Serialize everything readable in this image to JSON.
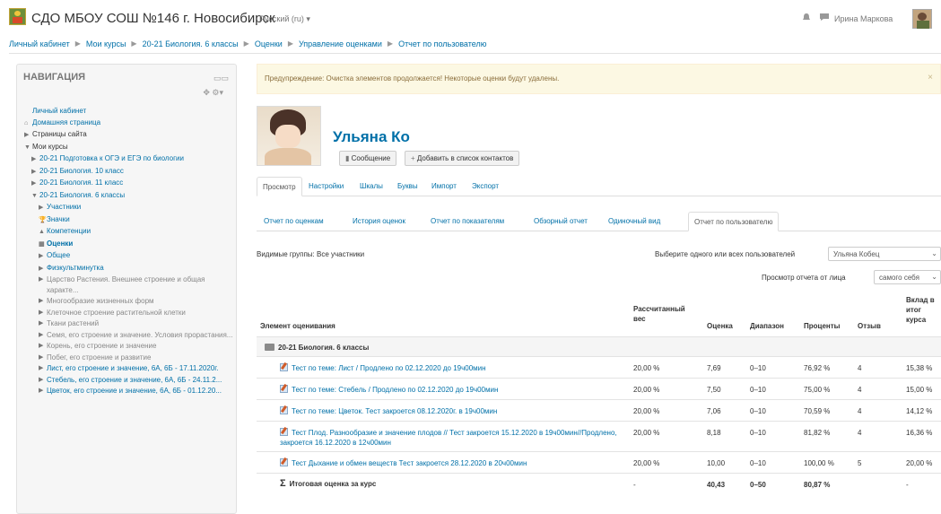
{
  "header": {
    "site_name": "СДО МБОУ СОШ №146 г. Новосибирск",
    "language": "Русский (ru) ▾",
    "user_name": "Ирина Маркова"
  },
  "breadcrumb": [
    "Личный кабинет",
    "Мои курсы",
    "20-21 Биология. 6 классы",
    "Оценки",
    "Управление оценками",
    "Отчет по пользователю"
  ],
  "navigation": {
    "title": "НАВИГАЦИЯ",
    "items": [
      {
        "label": "Личный кабинет",
        "arrow": "",
        "style": "link",
        "indent": 0
      },
      {
        "label": "Домашняя страница",
        "arrow": "⌂",
        "style": "link",
        "indent": 0
      },
      {
        "label": "Страницы сайта",
        "arrow": "▶",
        "style": "black",
        "indent": 0
      },
      {
        "label": "Мои курсы",
        "arrow": "▼",
        "style": "black",
        "indent": 0
      },
      {
        "label": "20-21 Подготовка к ОГЭ и ЕГЭ по биологии",
        "arrow": "▶",
        "style": "link",
        "indent": 1
      },
      {
        "label": "20-21 Биология. 10 класс",
        "arrow": "▶",
        "style": "link",
        "indent": 1
      },
      {
        "label": "20-21 Биология. 11 класс",
        "arrow": "▶",
        "style": "link",
        "indent": 1
      },
      {
        "label": "20-21 Биология. 6 классы",
        "arrow": "▼",
        "style": "link",
        "indent": 1
      },
      {
        "label": "Участники",
        "arrow": "▶",
        "style": "link",
        "indent": 2
      },
      {
        "label": "Значки",
        "arrow": "🏆",
        "style": "link",
        "indent": 2
      },
      {
        "label": "Компетенции",
        "arrow": "▲",
        "style": "link",
        "indent": 2
      },
      {
        "label": "Оценки",
        "arrow": "▦",
        "style": "bold",
        "indent": 2
      },
      {
        "label": "Общее",
        "arrow": "▶",
        "style": "link",
        "indent": 2
      },
      {
        "label": "Физкультминутка",
        "arrow": "▶",
        "style": "link",
        "indent": 2
      },
      {
        "label": "Царство Растения. Внешнее строение и общая характе...",
        "arrow": "▶",
        "style": "grey",
        "indent": 2
      },
      {
        "label": "Многообразие жизненных форм",
        "arrow": "▶",
        "style": "grey",
        "indent": 2
      },
      {
        "label": "Клеточное строение растительной клетки",
        "arrow": "▶",
        "style": "grey",
        "indent": 2
      },
      {
        "label": "Ткани растений",
        "arrow": "▶",
        "style": "grey",
        "indent": 2
      },
      {
        "label": "Семя, его строение и значение. Условия прорастания...",
        "arrow": "▶",
        "style": "grey",
        "indent": 2
      },
      {
        "label": "Корень, его строение и значение",
        "arrow": "▶",
        "style": "grey",
        "indent": 2
      },
      {
        "label": "Побег, его строение и развитие",
        "arrow": "▶",
        "style": "grey",
        "indent": 2
      },
      {
        "label": "Лист, его строение и значение, 6А, 6Б - 17.11.2020г.",
        "arrow": "▶",
        "style": "link",
        "indent": 2
      },
      {
        "label": "Стебель, его строение и значение, 6А, 6Б - 24.11.2...",
        "arrow": "▶",
        "style": "link",
        "indent": 2
      },
      {
        "label": "Цветок, его строение и значение, 6А, 6Б - 01.12.20...",
        "arrow": "▶",
        "style": "link",
        "indent": 2
      }
    ]
  },
  "warning": {
    "text": "Предупреждение: Очистка элементов продолжается! Некоторые оценки будут удалены.",
    "close": "×"
  },
  "profile": {
    "name": "Ульяна Ко",
    "message_button": "Сообщение",
    "add_contact_button": "Добавить в список контактов"
  },
  "tabs_primary": [
    "Просмотр",
    "Настройки",
    "Шкалы",
    "Буквы",
    "Импорт",
    "Экспорт"
  ],
  "tabs_secondary": [
    "Отчет по оценкам",
    "История оценок",
    "Отчет по показателям",
    "Обзорный отчет",
    "Одиночный вид",
    "Отчет по пользователю"
  ],
  "filters": {
    "groups": "Видимые группы: Все участники",
    "user_label": "Выберите одного или всех пользователей",
    "user_value": "Ульяна Кобец",
    "view_label": "Просмотр отчета от лица",
    "view_value": "самого себя"
  },
  "table": {
    "headers": {
      "item": "Элемент оценивания",
      "weight": "Рассчитанный вес",
      "grade": "Оценка",
      "range": "Диапазон",
      "percent": "Проценты",
      "feedback": "Отзыв",
      "contribution": "Вклад в итог курса"
    },
    "category": "20-21 Биология. 6 классы",
    "rows": [
      {
        "item": "Тест по теме: Лист / Продлено по 02.12.2020 до 19ч00мин",
        "weight": "20,00 %",
        "grade": "7,69",
        "range": "0–10",
        "percent": "76,92 %",
        "feedback": "4",
        "contribution": "15,38 %"
      },
      {
        "item": "Тест по теме: Стебель / Продлено по 02.12.2020 до 19ч00мин",
        "weight": "20,00 %",
        "grade": "7,50",
        "range": "0–10",
        "percent": "75,00 %",
        "feedback": "4",
        "contribution": "15,00 %"
      },
      {
        "item": "Тест по теме: Цветок. Тест закроется 08.12.2020г. в 19ч00мин",
        "weight": "20,00 %",
        "grade": "7,06",
        "range": "0–10",
        "percent": "70,59 %",
        "feedback": "4",
        "contribution": "14,12 %"
      },
      {
        "item": "Тест Плод. Разнообразие и значение плодов // Тест закроется 15.12.2020 в 19ч00мин//Продлено, закроется 16.12.2020 в 12ч00мин",
        "weight": "20,00 %",
        "grade": "8,18",
        "range": "0–10",
        "percent": "81,82 %",
        "feedback": "4",
        "contribution": "16,36 %"
      },
      {
        "item": "Тест Дыхание и обмен веществ Тест закроется 28.12.2020 в 20ч00мин",
        "weight": "20,00 %",
        "grade": "10,00",
        "range": "0–10",
        "percent": "100,00 %",
        "feedback": "5",
        "contribution": "20,00 %"
      }
    ],
    "total": {
      "item": "Итоговая оценка за курс",
      "weight": "-",
      "grade": "40,43",
      "range": "0–50",
      "percent": "80,87 %",
      "feedback": "",
      "contribution": "-"
    }
  }
}
